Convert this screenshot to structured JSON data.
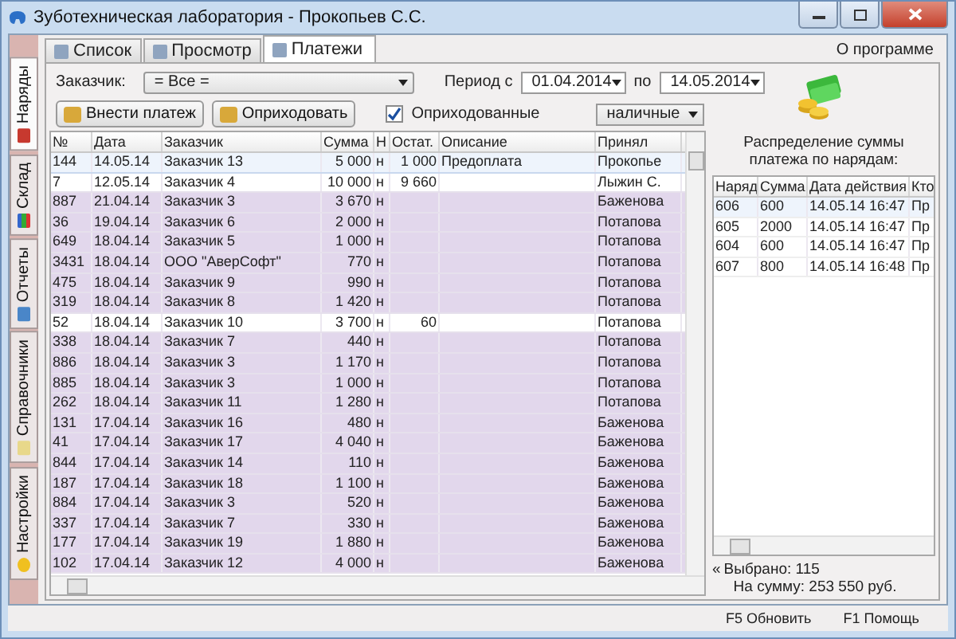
{
  "window": {
    "title": "Зуботехническая лаборатория - Прокопьев С.С."
  },
  "side_tabs": [
    {
      "label": "Наряды",
      "selected": true
    },
    {
      "label": "Склад",
      "selected": false
    },
    {
      "label": "Отчеты",
      "selected": false
    },
    {
      "label": "Справочники",
      "selected": false
    },
    {
      "label": "Настройки",
      "selected": false
    }
  ],
  "tabs": [
    {
      "label": "Список",
      "selected": false
    },
    {
      "label": "Просмотр",
      "selected": false
    },
    {
      "label": "Платежи",
      "selected": true
    }
  ],
  "about_link": "О программе",
  "filters": {
    "customer_label": "Заказчик:",
    "customer": "= Все =",
    "period_label": "Период с",
    "date_from": "01.04.2014",
    "to_label": "по",
    "date_to": "14.05.2014",
    "posted_label": "Оприходованные",
    "posted_checked": true,
    "pay_type": "наличные"
  },
  "buttons": [
    "Внести платеж",
    "Оприходовать"
  ],
  "table": {
    "columns": [
      "№",
      "Дата",
      "Заказчик",
      "Сумма",
      "Н",
      "Остат.",
      "Описание",
      "Принял"
    ],
    "rows": [
      {
        "cells": [
          "144",
          "14.05.14",
          "Заказчик 13",
          "5 000",
          "н",
          "1 000",
          "Предоплата",
          "Прокопье"
        ],
        "posted": false,
        "selected": true
      },
      {
        "cells": [
          "7",
          "12.05.14",
          "Заказчик 4",
          "10 000",
          "н",
          "9 660",
          "",
          "Лыжин С."
        ],
        "posted": false,
        "selected": false
      },
      {
        "cells": [
          "887",
          "21.04.14",
          "Заказчик 3",
          "3 670",
          "н",
          "",
          "",
          "Баженова"
        ],
        "posted": true,
        "selected": false
      },
      {
        "cells": [
          "36",
          "19.04.14",
          "Заказчик 6",
          "2 000",
          "н",
          "",
          "",
          "Потапова"
        ],
        "posted": true,
        "selected": false
      },
      {
        "cells": [
          "649",
          "18.04.14",
          "Заказчик 5",
          "1 000",
          "н",
          "",
          "",
          "Потапова"
        ],
        "posted": true,
        "selected": false
      },
      {
        "cells": [
          "3431",
          "18.04.14",
          "ООО \"АверСофт\"",
          "770",
          "н",
          "",
          "",
          "Потапова"
        ],
        "posted": true,
        "selected": false
      },
      {
        "cells": [
          "475",
          "18.04.14",
          "Заказчик 9",
          "990",
          "н",
          "",
          "",
          "Потапова"
        ],
        "posted": true,
        "selected": false
      },
      {
        "cells": [
          "319",
          "18.04.14",
          "Заказчик 8",
          "1 420",
          "н",
          "",
          "",
          "Потапова"
        ],
        "posted": true,
        "selected": false
      },
      {
        "cells": [
          "52",
          "18.04.14",
          "Заказчик 10",
          "3 700",
          "н",
          "60",
          "",
          "Потапова"
        ],
        "posted": false,
        "selected": false
      },
      {
        "cells": [
          "338",
          "18.04.14",
          "Заказчик 7",
          "440",
          "н",
          "",
          "",
          "Потапова"
        ],
        "posted": true,
        "selected": false
      },
      {
        "cells": [
          "886",
          "18.04.14",
          "Заказчик 3",
          "1 170",
          "н",
          "",
          "",
          "Потапова"
        ],
        "posted": true,
        "selected": false
      },
      {
        "cells": [
          "885",
          "18.04.14",
          "Заказчик 3",
          "1 000",
          "н",
          "",
          "",
          "Потапова"
        ],
        "posted": true,
        "selected": false
      },
      {
        "cells": [
          "262",
          "18.04.14",
          "Заказчик 11",
          "1 280",
          "н",
          "",
          "",
          "Потапова"
        ],
        "posted": true,
        "selected": false
      },
      {
        "cells": [
          "131",
          "17.04.14",
          "Заказчик 16",
          "480",
          "н",
          "",
          "",
          "Баженова"
        ],
        "posted": true,
        "selected": false
      },
      {
        "cells": [
          "41",
          "17.04.14",
          "Заказчик 17",
          "4 040",
          "н",
          "",
          "",
          "Баженова"
        ],
        "posted": true,
        "selected": false
      },
      {
        "cells": [
          "844",
          "17.04.14",
          "Заказчик 14",
          "110",
          "н",
          "",
          "",
          "Баженова"
        ],
        "posted": true,
        "selected": false
      },
      {
        "cells": [
          "187",
          "17.04.14",
          "Заказчик 18",
          "1 100",
          "н",
          "",
          "",
          "Баженова"
        ],
        "posted": true,
        "selected": false
      },
      {
        "cells": [
          "884",
          "17.04.14",
          "Заказчик 3",
          "520",
          "н",
          "",
          "",
          "Баженова"
        ],
        "posted": true,
        "selected": false
      },
      {
        "cells": [
          "337",
          "17.04.14",
          "Заказчик 7",
          "330",
          "н",
          "",
          "",
          "Баженова"
        ],
        "posted": true,
        "selected": false
      },
      {
        "cells": [
          "177",
          "17.04.14",
          "Заказчик 19",
          "1 880",
          "н",
          "",
          "",
          "Баженова"
        ],
        "posted": true,
        "selected": false
      },
      {
        "cells": [
          "102",
          "17.04.14",
          "Заказчик 12",
          "4 000",
          "н",
          "",
          "",
          "Баженова"
        ],
        "posted": true,
        "selected": false
      }
    ]
  },
  "distribution": {
    "title": "Распределение суммы платежа по нарядам:",
    "columns": [
      "Наряд",
      "Сумма",
      "Дата действия",
      "Кто"
    ],
    "rows": [
      [
        "606",
        "600",
        "14.05.14 16:47",
        "Пр"
      ],
      [
        "605",
        "2000",
        "14.05.14 16:47",
        "Пр"
      ],
      [
        "604",
        "600",
        "14.05.14 16:47",
        "Пр"
      ],
      [
        "607",
        "800",
        "14.05.14 16:48",
        "Пр"
      ]
    ],
    "collapse": "«",
    "selected_count": "Выбрано: 115",
    "selected_sum": "На сумму: 253 550 руб."
  },
  "status_bar": [
    "F5 Обновить",
    "F1 Помощь"
  ]
}
